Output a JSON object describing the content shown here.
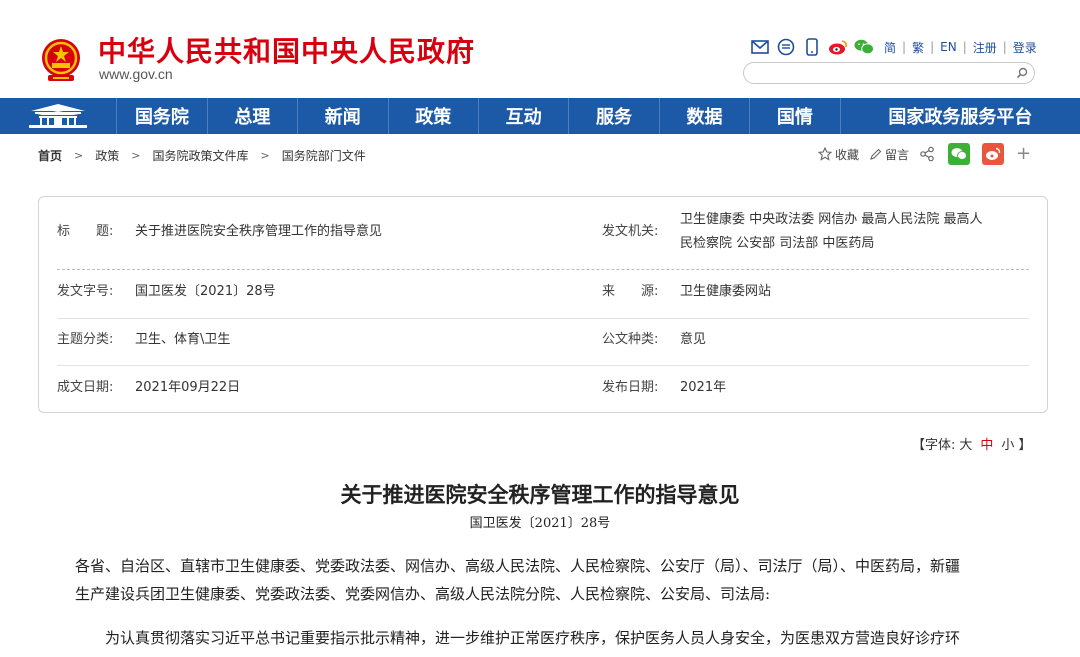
{
  "header": {
    "site_title": "中华人民共和国中央人民政府",
    "site_url": "www.gov.cn",
    "icons": [
      "mail-icon",
      "message-icon",
      "mobile-icon",
      "weibo-icon",
      "wechat-icon"
    ],
    "lang_links": [
      "简",
      "繁",
      "EN",
      "注册",
      "登录"
    ],
    "search_placeholder": ""
  },
  "nav": {
    "items": [
      "国务院",
      "总理",
      "新闻",
      "政策",
      "互动",
      "服务",
      "数据",
      "国情",
      "国家政务服务平台"
    ]
  },
  "breadcrumb": {
    "home": "首页",
    "items": [
      "政策",
      "国务院政策文件库",
      "国务院部门文件"
    ]
  },
  "share": {
    "favorite": "收藏",
    "comment": "留言",
    "plus": "+"
  },
  "info": {
    "title_label": "标　　题:",
    "title_value": "关于推进医院安全秩序管理工作的指导意见",
    "issuer_label": "发文机关:",
    "issuer_value_line1": "卫生健康委  中央政法委  网信办  最高人民法院  最高人",
    "issuer_value_line2": "民检察院  公安部  司法部  中医药局",
    "doc_no_label": "发文字号:",
    "doc_no_value": "国卫医发〔2021〕28号",
    "source_label": "来　　源:",
    "source_value": "卫生健康委网站",
    "topic_label": "主题分类:",
    "topic_value": "卫生、体育\\卫生",
    "type_label": "公文种类:",
    "type_value": "意见",
    "date_label": "成文日期:",
    "date_value": "2021年09月22日",
    "publish_label": "发布日期:",
    "publish_value": "2021年"
  },
  "font_ctl": {
    "prefix": "【字体:",
    "large": "大",
    "medium": "中",
    "small": "小",
    "suffix": "】"
  },
  "document": {
    "title": "关于推进医院安全秩序管理工作的指导意见",
    "number": "国卫医发〔2021〕28号",
    "para1_line1": "各省、自治区、直辖市卫生健康委、党委政法委、网信办、高级人民法院、人民检察院、公安厅（局）、司法厅（局）、中医药局，新疆",
    "para1_line2": "生产建设兵团卫生健康委、党委政法委、党委网信办、高级人民法院分院、人民检察院、公安局、司法局:",
    "para2_line1": "为认真贯彻落实习近平总书记重要指示批示精神，进一步维护正常医疗秩序，保护医务人员人身安全，为医患双方营造良好诊疗环"
  },
  "colors": {
    "brand_red": "#d7000f",
    "nav_blue": "#1c5aa8"
  }
}
